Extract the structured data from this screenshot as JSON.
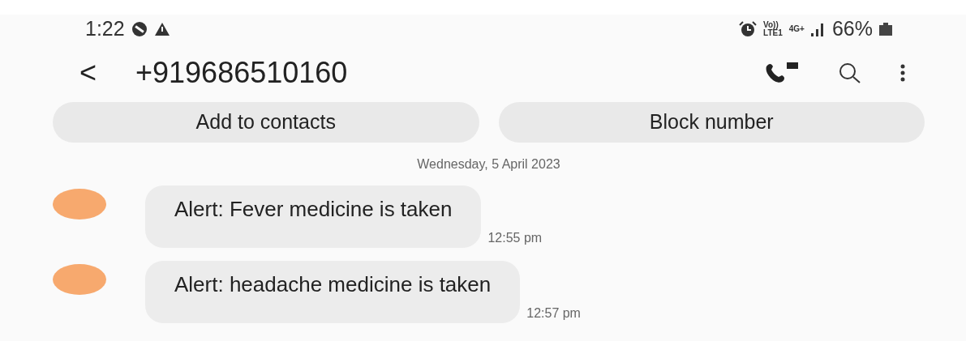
{
  "status_bar": {
    "time": "1:22",
    "network_labels": [
      "Vo))",
      "LTE1",
      "4G+"
    ],
    "battery": "66%"
  },
  "header": {
    "back": "<",
    "title": "+919686510160"
  },
  "actions": [
    "Add to contacts",
    "Block number"
  ],
  "date": "Wednesday, 5 April 2023",
  "messages": [
    {
      "text": "Alert: Fever medicine is taken",
      "time": "12:55 pm"
    },
    {
      "text": "Alert: headache medicine is taken",
      "time": "12:57 pm"
    }
  ]
}
